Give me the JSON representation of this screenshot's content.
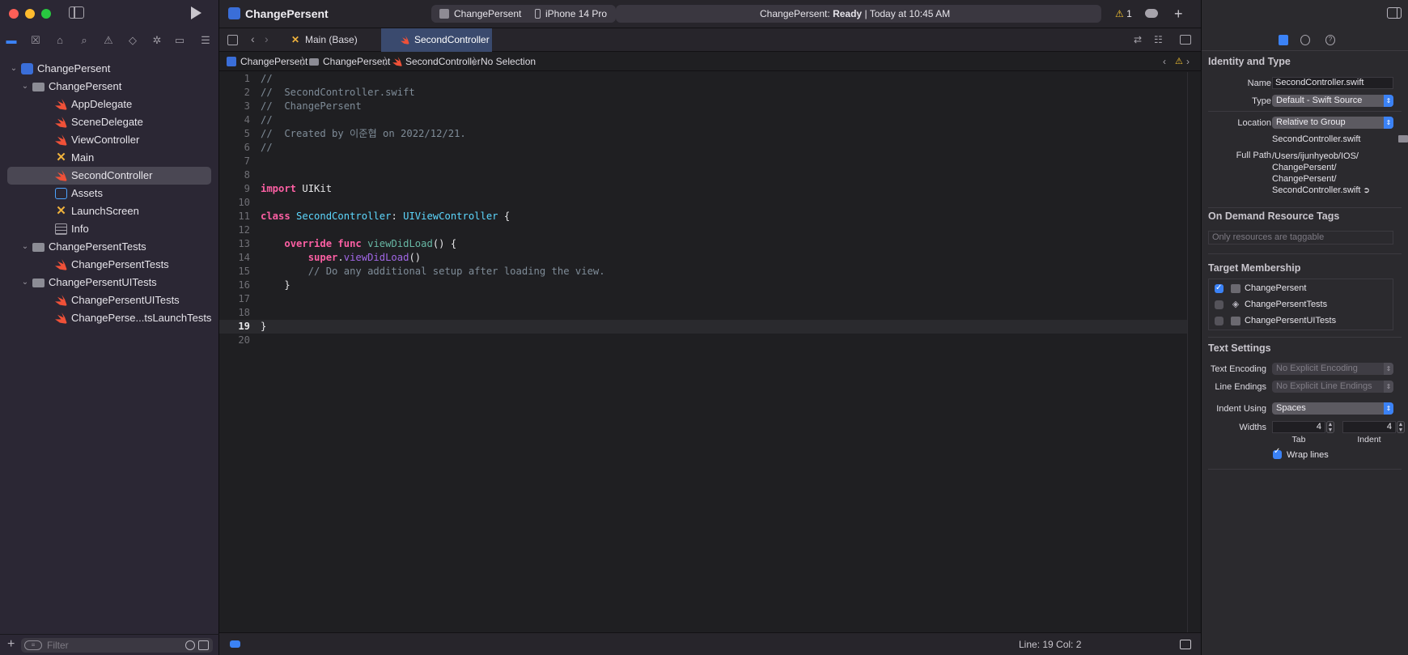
{
  "app": {
    "title": "ChangePersent"
  },
  "toolbar": {
    "scheme": "ChangePersent",
    "device": "iPhone 14 Pro",
    "status_app": "ChangePersent:",
    "status_state": "Ready",
    "status_time": "| Today at 10:45 AM",
    "warning_count": "1"
  },
  "navigator": {
    "items": [
      {
        "label": "ChangePersent",
        "kind": "project",
        "level": 0,
        "expanded": true
      },
      {
        "label": "ChangePersent",
        "kind": "folder",
        "level": 1,
        "expanded": true
      },
      {
        "label": "AppDelegate",
        "kind": "swift",
        "level": 2
      },
      {
        "label": "SceneDelegate",
        "kind": "swift",
        "level": 2
      },
      {
        "label": "ViewController",
        "kind": "swift",
        "level": 2
      },
      {
        "label": "Main",
        "kind": "storyboard",
        "level": 2
      },
      {
        "label": "SecondController",
        "kind": "swift",
        "level": 2,
        "selected": true
      },
      {
        "label": "Assets",
        "kind": "assets",
        "level": 2
      },
      {
        "label": "LaunchScreen",
        "kind": "storyboard",
        "level": 2
      },
      {
        "label": "Info",
        "kind": "plist",
        "level": 2
      },
      {
        "label": "ChangePersentTests",
        "kind": "folder",
        "level": 1,
        "expanded": true
      },
      {
        "label": "ChangePersentTests",
        "kind": "swift",
        "level": 2
      },
      {
        "label": "ChangePersentUITests",
        "kind": "folder",
        "level": 1,
        "expanded": true
      },
      {
        "label": "ChangePersentUITests",
        "kind": "swift",
        "level": 2
      },
      {
        "label": "ChangePerse...tsLaunchTests",
        "kind": "swift",
        "level": 2
      }
    ],
    "filter_placeholder": "Filter"
  },
  "tabs": [
    {
      "label": "Main (Base)",
      "active": false
    },
    {
      "label": "SecondController",
      "active": true
    }
  ],
  "jumpbar": {
    "crumbs": [
      "ChangePersent",
      "ChangePersent",
      "SecondController",
      "No Selection"
    ]
  },
  "editor": {
    "current_line": 19,
    "lines": [
      [
        [
          "c-com",
          "//"
        ]
      ],
      [
        [
          "c-com",
          "//  SecondController.swift"
        ]
      ],
      [
        [
          "c-com",
          "//  ChangePersent"
        ]
      ],
      [
        [
          "c-com",
          "//"
        ]
      ],
      [
        [
          "c-com",
          "//  Created by 이준협 on 2022/12/21."
        ]
      ],
      [
        [
          "c-com",
          "//"
        ]
      ],
      [],
      [],
      [
        [
          "c-kw",
          "import"
        ],
        [
          "c-plain",
          " UIKit"
        ]
      ],
      [],
      [
        [
          "c-kw",
          "class"
        ],
        [
          "c-plain",
          " "
        ],
        [
          "c-type",
          "SecondController"
        ],
        [
          "c-plain",
          ": "
        ],
        [
          "c-type",
          "UIViewController"
        ],
        [
          "c-plain",
          " {"
        ]
      ],
      [],
      [
        [
          "c-plain",
          "    "
        ],
        [
          "c-kw",
          "override"
        ],
        [
          "c-plain",
          " "
        ],
        [
          "c-kw",
          "func"
        ],
        [
          "c-plain",
          " "
        ],
        [
          "c-func",
          "viewDidLoad"
        ],
        [
          "c-plain",
          "() {"
        ]
      ],
      [
        [
          "c-plain",
          "        "
        ],
        [
          "c-kw",
          "super"
        ],
        [
          "c-plain",
          "."
        ],
        [
          "c-call",
          "viewDidLoad"
        ],
        [
          "c-plain",
          "()"
        ]
      ],
      [
        [
          "c-plain",
          "        "
        ],
        [
          "c-com",
          "// Do any additional setup after loading the view."
        ]
      ],
      [
        [
          "c-plain",
          "    }"
        ]
      ],
      [],
      [],
      [
        [
          "c-plain",
          "}"
        ]
      ],
      []
    ]
  },
  "statusbar": {
    "cursor": "Line: 19  Col: 2"
  },
  "inspector": {
    "identity_title": "Identity and Type",
    "name_label": "Name",
    "name_value": "SecondController.swift",
    "type_label": "Type",
    "type_value": "Default - Swift Source",
    "location_label": "Location",
    "location_value": "Relative to Group",
    "location_file": "SecondController.swift",
    "fullpath_label": "Full Path",
    "fullpath_lines": [
      "/Users/ijunhyeob/IOS/",
      "ChangePersent/",
      "ChangePersent/",
      "SecondController.swift"
    ],
    "ondemand_title": "On Demand Resource Tags",
    "ondemand_placeholder": "Only resources are taggable",
    "membership_title": "Target Membership",
    "membership": [
      {
        "label": "ChangePersent",
        "checked": true
      },
      {
        "label": "ChangePersentTests",
        "checked": false
      },
      {
        "label": "ChangePersentUITests",
        "checked": false
      }
    ],
    "text_settings_title": "Text Settings",
    "encoding_label": "Text Encoding",
    "encoding_value": "No Explicit Encoding",
    "line_endings_label": "Line Endings",
    "line_endings_value": "No Explicit Line Endings",
    "indent_using_label": "Indent Using",
    "indent_using_value": "Spaces",
    "widths_label": "Widths",
    "tab_width": "4",
    "indent_width": "4",
    "tab_caption": "Tab",
    "indent_caption": "Indent",
    "wrap_lines_label": "Wrap lines",
    "wrap_lines": true
  }
}
